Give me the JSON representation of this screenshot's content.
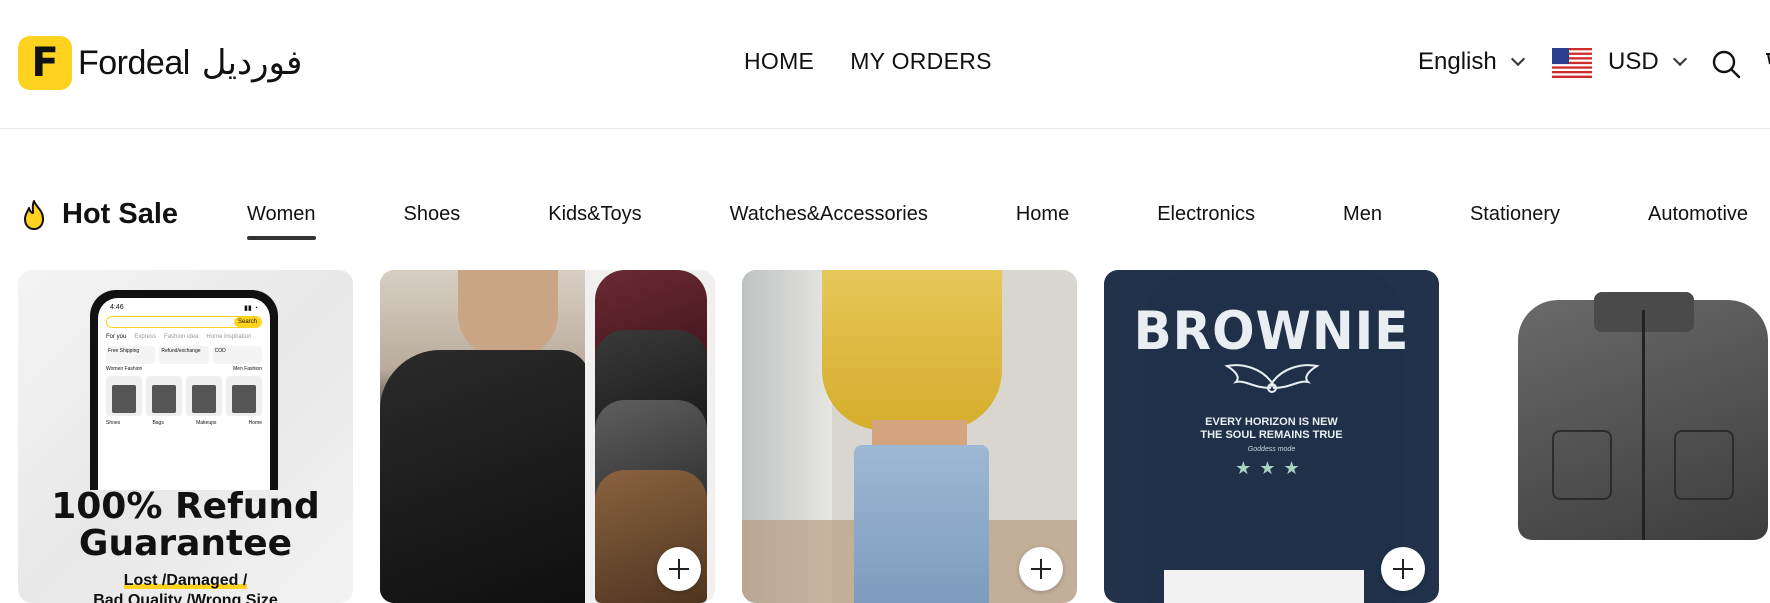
{
  "brand": {
    "logo_letter": "F",
    "name": "Fordeal",
    "name_arabic": "فورديل",
    "logo_color": "#ffd21f"
  },
  "nav": {
    "items": [
      "HOME",
      "MY ORDERS"
    ]
  },
  "locale": {
    "language": "English",
    "currency": "USD",
    "flag": "us-flag-icon"
  },
  "hot_sale": {
    "title": "Hot Sale",
    "icon": "fire-icon",
    "tabs": [
      "Women",
      "Shoes",
      "Kids&Toys",
      "Watches&Accessories",
      "Home",
      "Electronics",
      "Men",
      "Stationery",
      "Automotive"
    ],
    "active_tab": "Women"
  },
  "promo": {
    "title_line1": "100% Refund",
    "title_line2": "Guarantee",
    "sub_line1": "Lost  /Damaged /",
    "sub_line2": "Bad Quality /Wrong Size",
    "phone": {
      "time": "4:46",
      "search_button": "Search",
      "tabs": [
        "For you",
        "Express",
        "Fashion idea",
        "Home inspiration"
      ],
      "perks": [
        "Free Shipping",
        "Refund/exchange",
        "COD"
      ],
      "sections": [
        "Women Fashion",
        "Men Fashion"
      ],
      "cells": [
        "Shoes",
        "Bags",
        "Makeups",
        "Home"
      ]
    }
  },
  "product_cards": {
    "hoodie_print": {
      "brand": "BROWNIE",
      "line1": "EVERY HORIZON IS NEW",
      "line2": "THE SOUL REMAINS TRUE",
      "script": "Goddess mode",
      "stars": "★★★"
    }
  }
}
